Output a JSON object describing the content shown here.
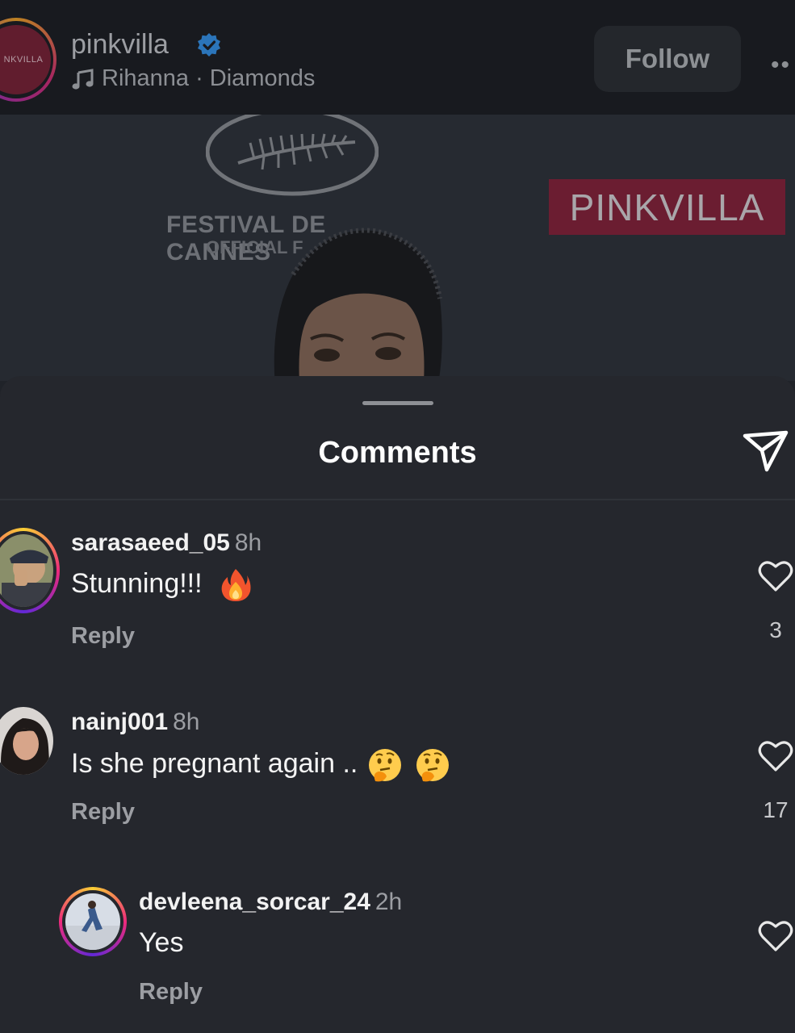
{
  "header": {
    "account": "pinkvilla",
    "avatar_text": "NKVILLA",
    "music": "Rihanna · Diamonds",
    "follow_label": "Follow",
    "more_label": "••"
  },
  "photo": {
    "festival_title": "FESTIVAL DE CANNES",
    "festival_sub": "OFFICIAL F",
    "banner": "PINKVILLA"
  },
  "sheet": {
    "title": "Comments"
  },
  "comments": [
    {
      "user": "sarasaeed_05",
      "time": "8h",
      "text": "Stunning!!!",
      "emoji": "fire",
      "reply_label": "Reply",
      "likes": "3"
    },
    {
      "user": "nainj001",
      "time": "8h",
      "text": "Is she pregnant again ..",
      "emoji": "thinking-face x2",
      "reply_label": "Reply",
      "likes": "17"
    },
    {
      "user": "devleena_sorcar_24",
      "time": "2h",
      "text": "Yes",
      "reply_label": "Reply",
      "likes": ""
    }
  ],
  "colors": {
    "sheet_bg": "#25272d",
    "header_bg": "#181a1f",
    "verified_blue": "#3897f0",
    "story_ring": [
      "#f9ce34",
      "#ee2a7b",
      "#6228d7"
    ]
  }
}
